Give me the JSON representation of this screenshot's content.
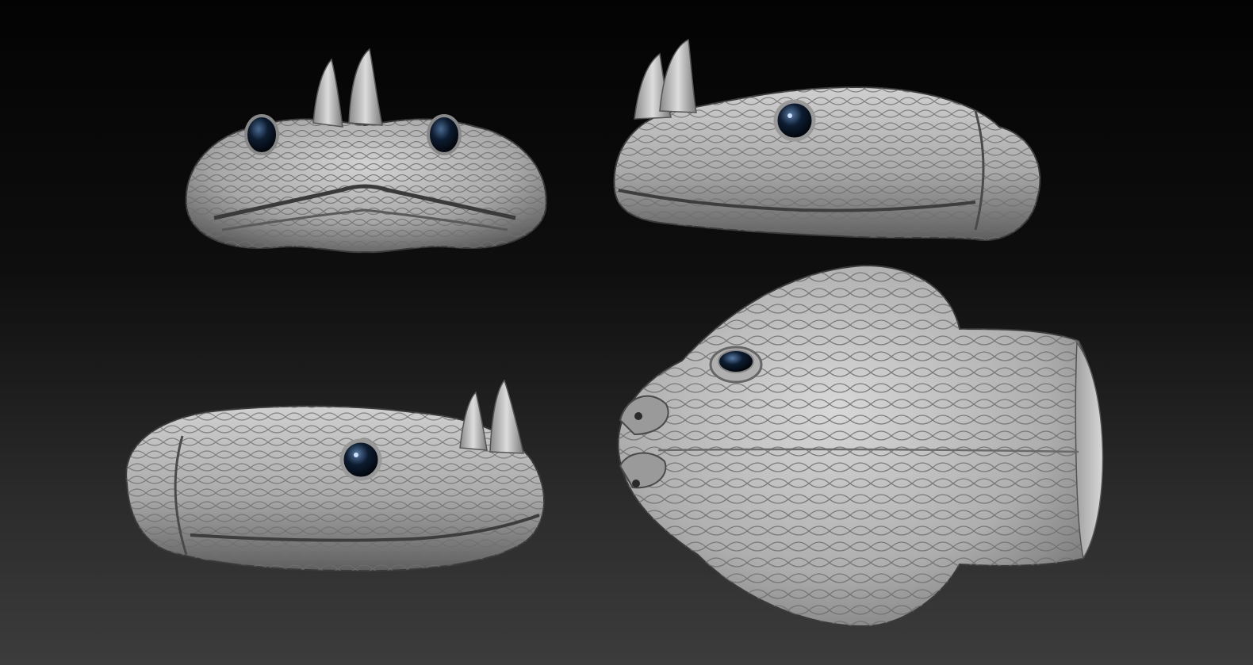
{
  "scene": {
    "background_top": "#030303",
    "background_bottom": "#3c3c3c",
    "material_color": "#b9b9b9",
    "eye_color": "#0b1a2e",
    "views": [
      {
        "id": "front",
        "icon": "snake-head-front-view"
      },
      {
        "id": "right",
        "icon": "snake-head-right-profile"
      },
      {
        "id": "left",
        "icon": "snake-head-left-profile"
      },
      {
        "id": "top",
        "icon": "snake-head-top-view"
      }
    ]
  }
}
